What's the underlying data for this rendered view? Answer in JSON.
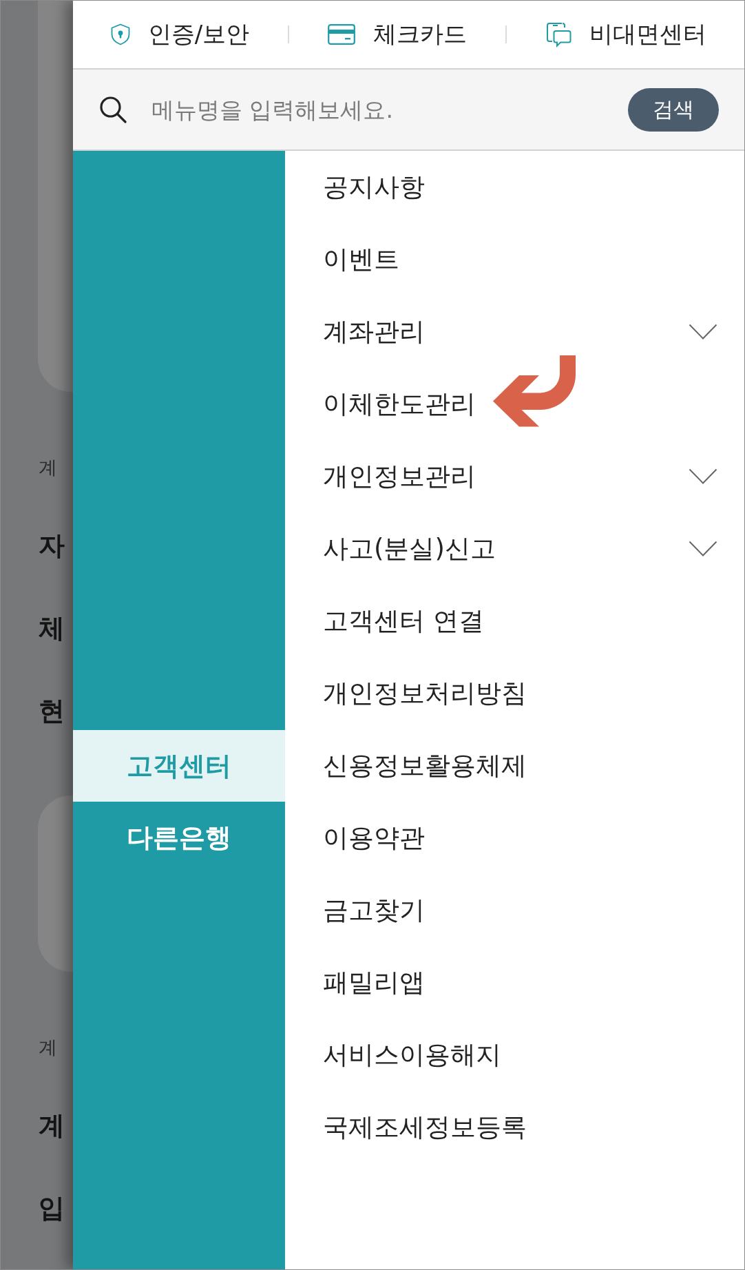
{
  "background": {
    "sections": [
      {
        "caption": "계",
        "headings": [
          "자",
          "체",
          "현"
        ]
      },
      {
        "caption": "계",
        "headings": [
          "계",
          "입"
        ]
      }
    ]
  },
  "drawer": {
    "shortcuts": [
      {
        "label": "인증/보안"
      },
      {
        "label": "체크카드"
      },
      {
        "label": "비대면센터"
      }
    ],
    "search": {
      "placeholder": "메뉴명을 입력해보세요.",
      "button": "검색"
    },
    "categories": [
      {
        "label": "고객센터",
        "selected": true
      },
      {
        "label": "다른은행",
        "selected": false
      }
    ],
    "menu": [
      {
        "label": "공지사항",
        "kind": "link",
        "marked": false
      },
      {
        "label": "이벤트",
        "kind": "link",
        "marked": false
      },
      {
        "label": "계좌관리",
        "kind": "group",
        "marked": false
      },
      {
        "label": "이체한도관리",
        "kind": "link",
        "marked": true
      },
      {
        "label": "개인정보관리",
        "kind": "group",
        "marked": false
      },
      {
        "label": "사고(분실)신고",
        "kind": "group",
        "marked": false
      },
      {
        "label": "고객센터 연결",
        "kind": "link",
        "marked": false
      },
      {
        "label": "개인정보처리방침",
        "kind": "link",
        "marked": false
      },
      {
        "label": "신용정보활용체제",
        "kind": "link",
        "marked": false
      },
      {
        "label": "이용약관",
        "kind": "link",
        "marked": false
      },
      {
        "label": "금고찾기",
        "kind": "link",
        "marked": false
      },
      {
        "label": "패밀리앱",
        "kind": "link",
        "marked": false
      },
      {
        "label": "서비스이용해지",
        "kind": "link",
        "marked": false
      },
      {
        "label": "국제조세정보등록",
        "kind": "link",
        "marked": false
      }
    ]
  }
}
